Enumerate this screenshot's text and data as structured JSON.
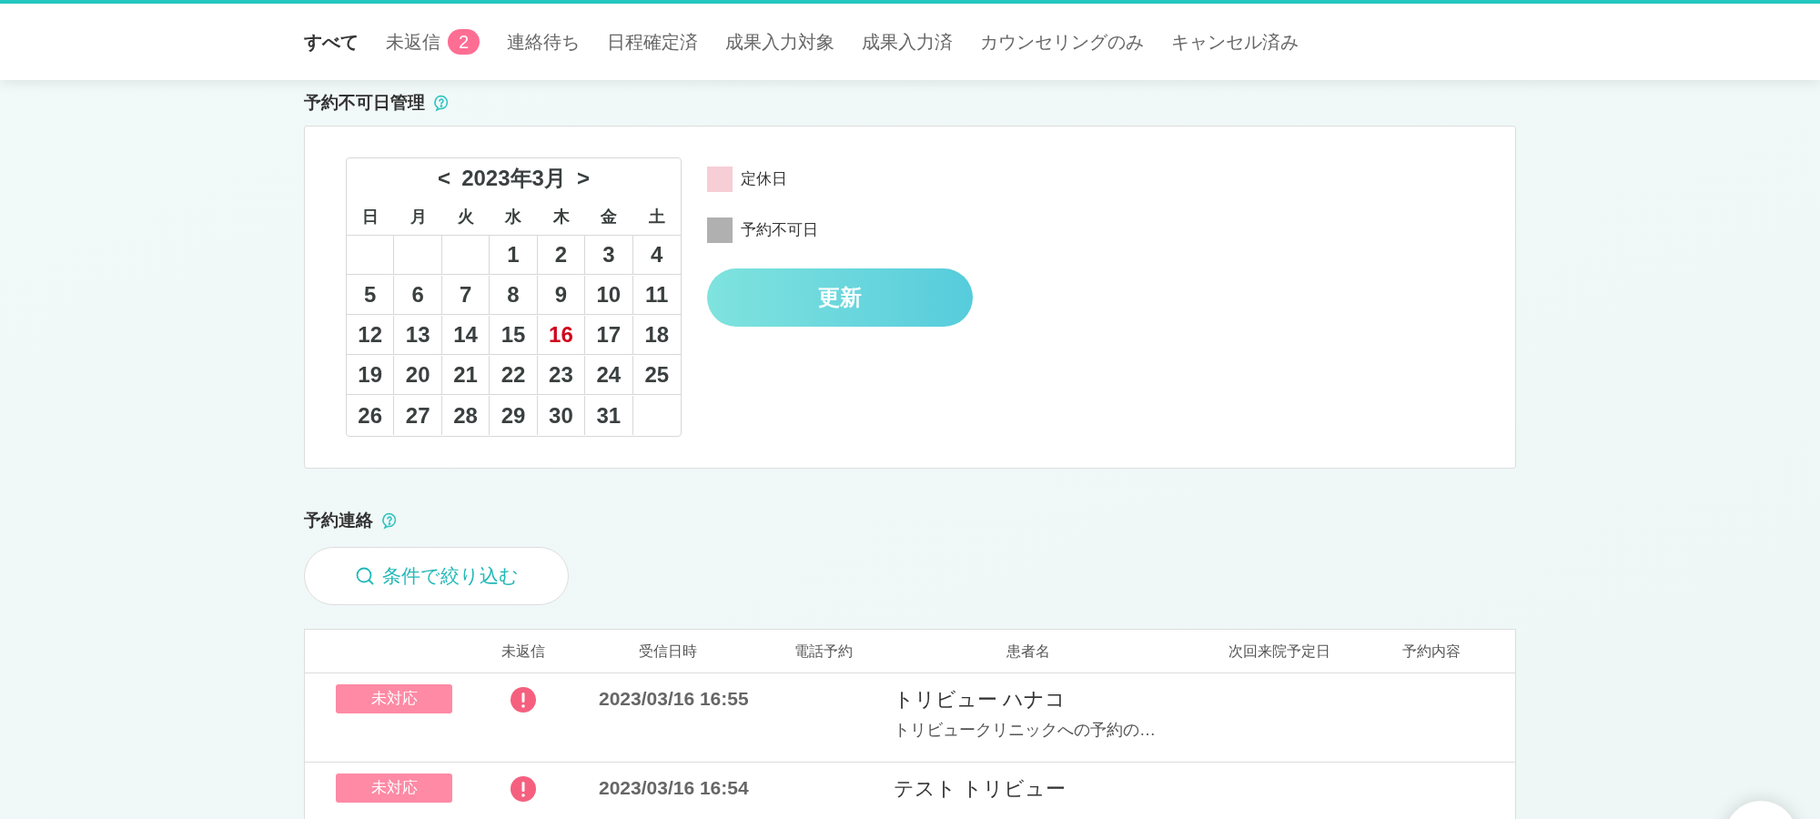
{
  "tabs": [
    {
      "label": "すべて",
      "selected": true
    },
    {
      "label": "未返信",
      "selected": false,
      "count": "2"
    },
    {
      "label": "連絡待ち",
      "selected": false
    },
    {
      "label": "日程確定済",
      "selected": false
    },
    {
      "label": "成果入力対象",
      "selected": false
    },
    {
      "label": "成果入力済",
      "selected": false
    },
    {
      "label": "カウンセリングのみ",
      "selected": false
    },
    {
      "label": "キャンセル済み",
      "selected": false
    }
  ],
  "unavailable_days": {
    "title": "予約不可日管理",
    "calendar": {
      "prev": "<",
      "month": "2023年3月",
      "next": ">",
      "weekdays": [
        "日",
        "月",
        "火",
        "水",
        "木",
        "金",
        "土"
      ],
      "weeks": [
        [
          {
            "kind": "empty"
          },
          {
            "kind": "empty"
          },
          {
            "kind": "empty"
          },
          {
            "kind": "day",
            "day": "1",
            "today": false
          },
          {
            "kind": "day",
            "day": "2",
            "today": false
          },
          {
            "kind": "day",
            "day": "3",
            "today": false
          },
          {
            "kind": "day",
            "day": "4",
            "today": false
          }
        ],
        [
          {
            "kind": "day",
            "day": "5",
            "today": false
          },
          {
            "kind": "day",
            "day": "6",
            "today": false
          },
          {
            "kind": "day",
            "day": "7",
            "today": false
          },
          {
            "kind": "day",
            "day": "8",
            "today": false
          },
          {
            "kind": "day",
            "day": "9",
            "today": false
          },
          {
            "kind": "day",
            "day": "10",
            "today": false
          },
          {
            "kind": "day",
            "day": "11",
            "today": false
          }
        ],
        [
          {
            "kind": "day",
            "day": "12",
            "today": false
          },
          {
            "kind": "day",
            "day": "13",
            "today": false
          },
          {
            "kind": "day",
            "day": "14",
            "today": false
          },
          {
            "kind": "day",
            "day": "15",
            "today": false
          },
          {
            "kind": "day",
            "day": "16",
            "today": true
          },
          {
            "kind": "day",
            "day": "17",
            "today": false
          },
          {
            "kind": "day",
            "day": "18",
            "today": false
          }
        ],
        [
          {
            "kind": "day",
            "day": "19",
            "today": false
          },
          {
            "kind": "day",
            "day": "20",
            "today": false
          },
          {
            "kind": "day",
            "day": "21",
            "today": false
          },
          {
            "kind": "day",
            "day": "22",
            "today": false
          },
          {
            "kind": "day",
            "day": "23",
            "today": false
          },
          {
            "kind": "day",
            "day": "24",
            "today": false
          },
          {
            "kind": "day",
            "day": "25",
            "today": false
          }
        ],
        [
          {
            "kind": "day",
            "day": "26",
            "today": false
          },
          {
            "kind": "day",
            "day": "27",
            "today": false
          },
          {
            "kind": "day",
            "day": "28",
            "today": false
          },
          {
            "kind": "day",
            "day": "29",
            "today": false
          },
          {
            "kind": "day",
            "day": "30",
            "today": false
          },
          {
            "kind": "day",
            "day": "31",
            "today": false
          },
          {
            "kind": "empty"
          }
        ]
      ]
    },
    "legend": [
      {
        "label": "定休日",
        "color": "#f7cdd6"
      },
      {
        "label": "予約不可日",
        "color": "#b0b0b0"
      }
    ],
    "update_button": "更新"
  },
  "contacts": {
    "title": "予約連絡",
    "filter_button": "条件で絞り込む",
    "table": {
      "columns": [
        "未返信",
        "受信日時",
        "電話予約",
        "患者名",
        "次回来院予定日",
        "予約内容"
      ],
      "rows": [
        {
          "status": "未対応",
          "unreplied": true,
          "received": "2023/03/16 16:55",
          "patient": "トリビュー ハナコ",
          "message": "トリビュークリニックへの予約の…"
        },
        {
          "status": "未対応",
          "unreplied": true,
          "received": "2023/03/16 16:54",
          "patient": "テスト トリビュー"
        }
      ]
    }
  }
}
